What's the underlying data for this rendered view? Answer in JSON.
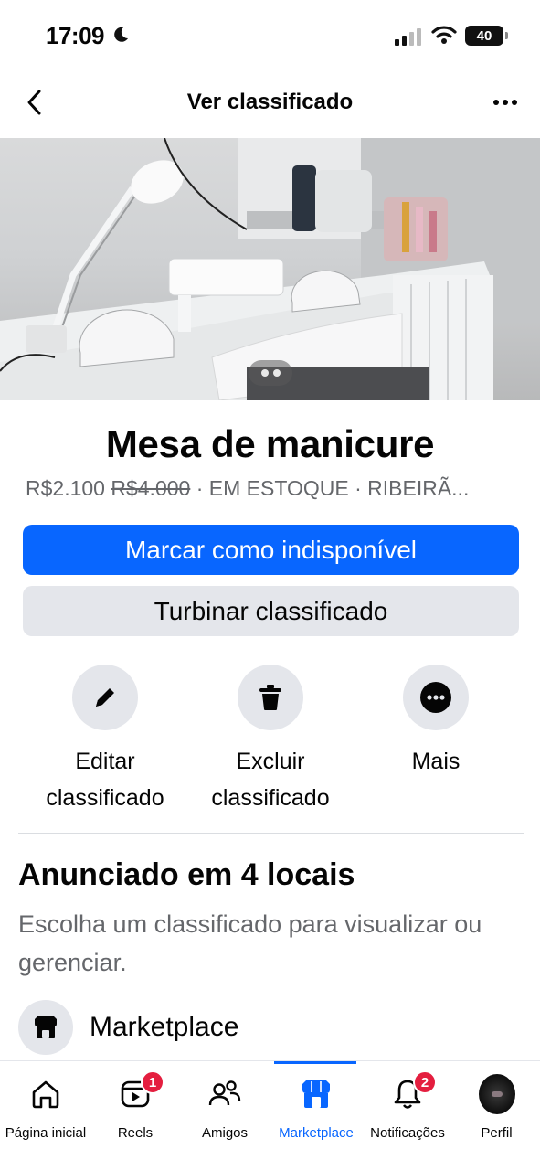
{
  "status_bar": {
    "time": "17:09",
    "battery": "40",
    "icons": [
      "moon-icon",
      "signal-icon",
      "wifi-icon",
      "battery-icon"
    ]
  },
  "header": {
    "title": "Ver classificado",
    "back_icon": "chevron-left-icon",
    "more_icon": "more-horizontal-icon"
  },
  "listing": {
    "photo_count": 2,
    "photo_current": 1,
    "title": "Mesa de manicure",
    "price": "R$2.100",
    "old_price": "R$4.000",
    "meta_rest": " · EM ESTOQUE · RIBEIRÃ..."
  },
  "buttons": {
    "mark_unavailable": "Marcar como indisponível",
    "boost": "Turbinar classificado"
  },
  "actions": [
    {
      "label_line1": "Editar",
      "label_line2": "classificado",
      "icon": "pencil-icon"
    },
    {
      "label_line1": "Excluir",
      "label_line2": "classificado",
      "icon": "trash-icon"
    },
    {
      "label_line1": "Mais",
      "label_line2": "",
      "icon": "more-circle-icon"
    }
  ],
  "locations": {
    "title": "Anunciado em 4 locais",
    "description": "Escolha um classificado para visualizar ou gerenciar.",
    "first_item": "Marketplace"
  },
  "bottom_nav": {
    "items": [
      {
        "label": "Página inicial",
        "icon": "home-icon",
        "badge": ""
      },
      {
        "label": "Reels",
        "icon": "reels-icon",
        "badge": "1"
      },
      {
        "label": "Amigos",
        "icon": "friends-icon",
        "badge": ""
      },
      {
        "label": "Marketplace",
        "icon": "marketplace-icon",
        "badge": ""
      },
      {
        "label": "Notificações",
        "icon": "bell-icon",
        "badge": "2"
      },
      {
        "label": "Perfil",
        "icon": "avatar",
        "badge": ""
      }
    ],
    "active": "Marketplace"
  },
  "colors": {
    "primary": "#0866ff",
    "secondary_bg": "#e4e6eb",
    "badge": "#e41e3f",
    "muted_text": "#65676b"
  }
}
